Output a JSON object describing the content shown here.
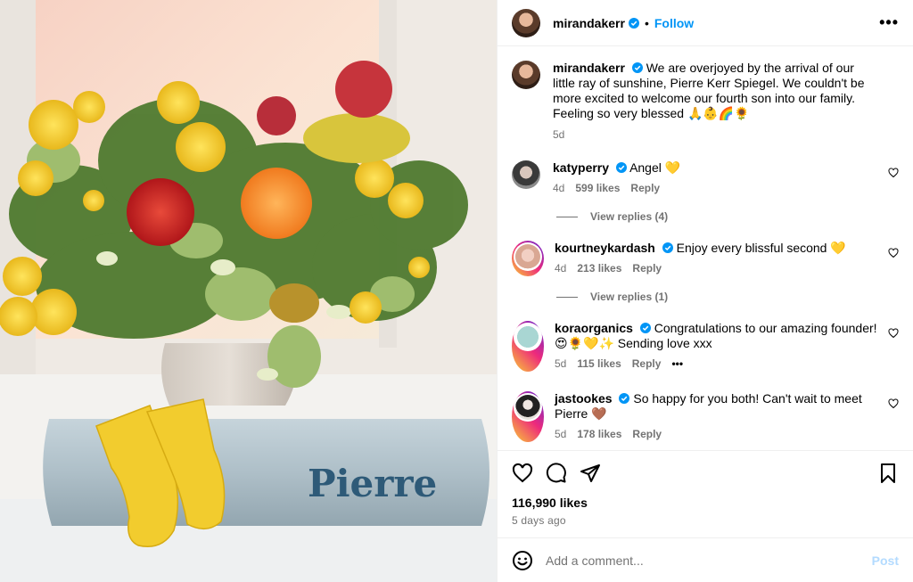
{
  "post": {
    "username": "mirandakerr",
    "follow_label": "Follow",
    "more_label": "•••",
    "separator": "•",
    "caption": "We are overjoyed by the arrival of our little ray of sunshine, Pierre Kerr Spiegel. We couldn't be more excited to welcome our fourth son into our family. Feeling so very blessed 🙏👶🌈🌻",
    "caption_time": "5d",
    "blanket_text": "Pierre"
  },
  "comments": [
    {
      "username": "katyperry",
      "text": "Angel 💛",
      "time": "4d",
      "likes": "599 likes",
      "reply": "Reply",
      "view_replies": "View replies (4)"
    },
    {
      "username": "kourtneykardash",
      "text": "Enjoy every blissful second 💛",
      "time": "4d",
      "likes": "213 likes",
      "reply": "Reply",
      "view_replies": "View replies (1)"
    },
    {
      "username": "koraorganics",
      "text": "Congratulations to our amazing founder! 😍🌻💛✨ Sending love xxx",
      "time": "5d",
      "likes": "115 likes",
      "reply": "Reply",
      "more": "•••"
    },
    {
      "username": "jastookes",
      "text": "So happy for you both! Can't wait to meet Pierre 🤎",
      "time": "5d",
      "likes": "178 likes",
      "reply": "Reply"
    }
  ],
  "footer": {
    "likes": "116,990 likes",
    "posted": "5 days ago",
    "comment_placeholder": "Add a comment...",
    "post_label": "Post"
  },
  "colors": {
    "accent": "#0095f6",
    "verified": "#0095f6",
    "muted": "#737373",
    "post_disabled": "#b3dbff"
  }
}
